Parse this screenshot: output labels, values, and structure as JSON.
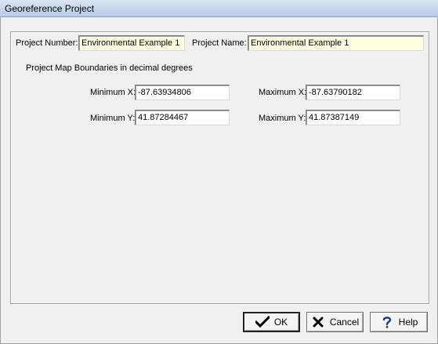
{
  "window": {
    "title": "Georeference Project"
  },
  "project": {
    "number_label": "Project Number:",
    "number_value": "Environmental Example 1",
    "name_label": "Project Name:",
    "name_value": "Environmental Example 1"
  },
  "boundaries": {
    "heading": "Project Map Boundaries in decimal degrees",
    "min_x_label": "Minimum X:",
    "min_x_value": "-87.63934806",
    "max_x_label": "Maximum X:",
    "max_x_value": "-87.63790182",
    "min_y_label": "Minimum Y:",
    "min_y_value": "41.87284467",
    "max_y_label": "Maximum Y:",
    "max_y_value": "41.87387149"
  },
  "buttons": {
    "ok_label": "OK",
    "cancel_label": "Cancel",
    "help_label": "Help"
  },
  "icons": {
    "ok": "checkmark-icon",
    "cancel": "x-icon",
    "help": "question-mark-icon"
  }
}
